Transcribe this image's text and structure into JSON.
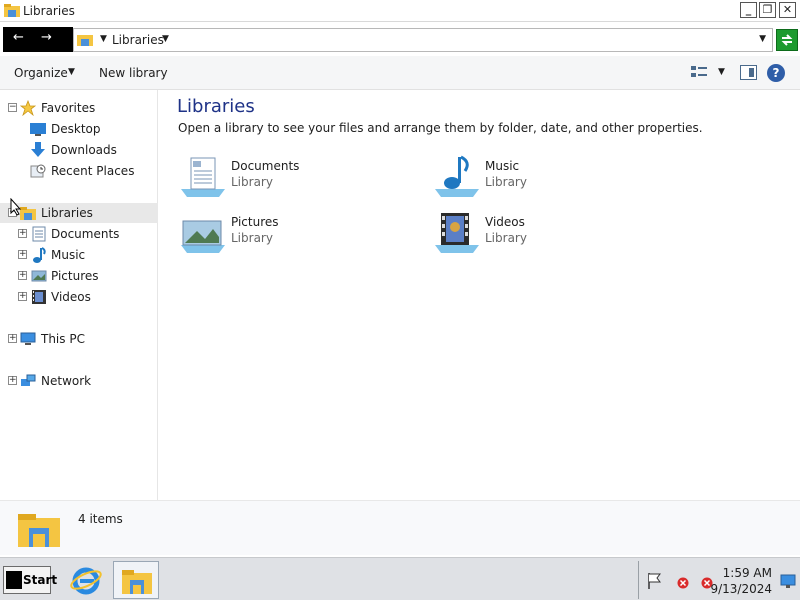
{
  "window": {
    "title": "Libraries",
    "minimize_label": "_",
    "maximize_label": "❐",
    "close_label": "✕"
  },
  "nav_buttons": {
    "back": "←",
    "forward": "→"
  },
  "address": {
    "crumb": "Libraries"
  },
  "toolbar": {
    "organize": "Organize",
    "new_library": "New library",
    "help": "?"
  },
  "sidebar": {
    "favorites": "Favorites",
    "desktop": "Desktop",
    "downloads": "Downloads",
    "recent": "Recent Places",
    "libraries": "Libraries",
    "documents": "Documents",
    "music": "Music",
    "pictures": "Pictures",
    "videos": "Videos",
    "this_pc": "This PC",
    "network": "Network"
  },
  "content": {
    "heading": "Libraries",
    "description": "Open a library to see your files and arrange them by folder, date, and other properties.",
    "libraries": [
      {
        "name": "Documents",
        "type": "Library"
      },
      {
        "name": "Music",
        "type": "Library"
      },
      {
        "name": "Pictures",
        "type": "Library"
      },
      {
        "name": "Videos",
        "type": "Library"
      }
    ]
  },
  "details": {
    "count": "4 items"
  },
  "taskbar": {
    "start": "Start",
    "time": "1:59 AM",
    "date": "9/13/2024"
  },
  "colors": {
    "accent": "#1e3287",
    "selection": "#e8e8e8",
    "go_button": "#1d9b2f"
  }
}
